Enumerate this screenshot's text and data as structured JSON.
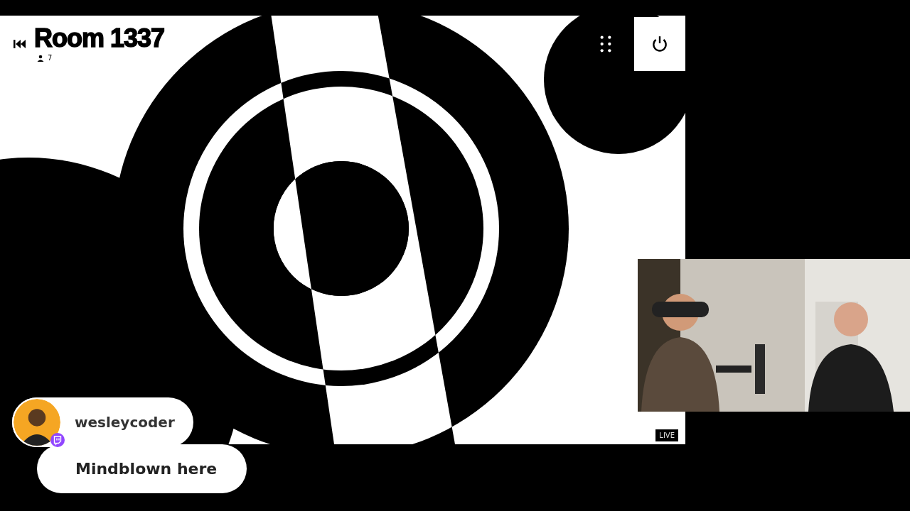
{
  "stage": {
    "title": "Room 1337",
    "viewer_count": "7",
    "live_label": "LIVE"
  },
  "chat": {
    "username": "wesleycoder",
    "message": "Mindblown here"
  }
}
